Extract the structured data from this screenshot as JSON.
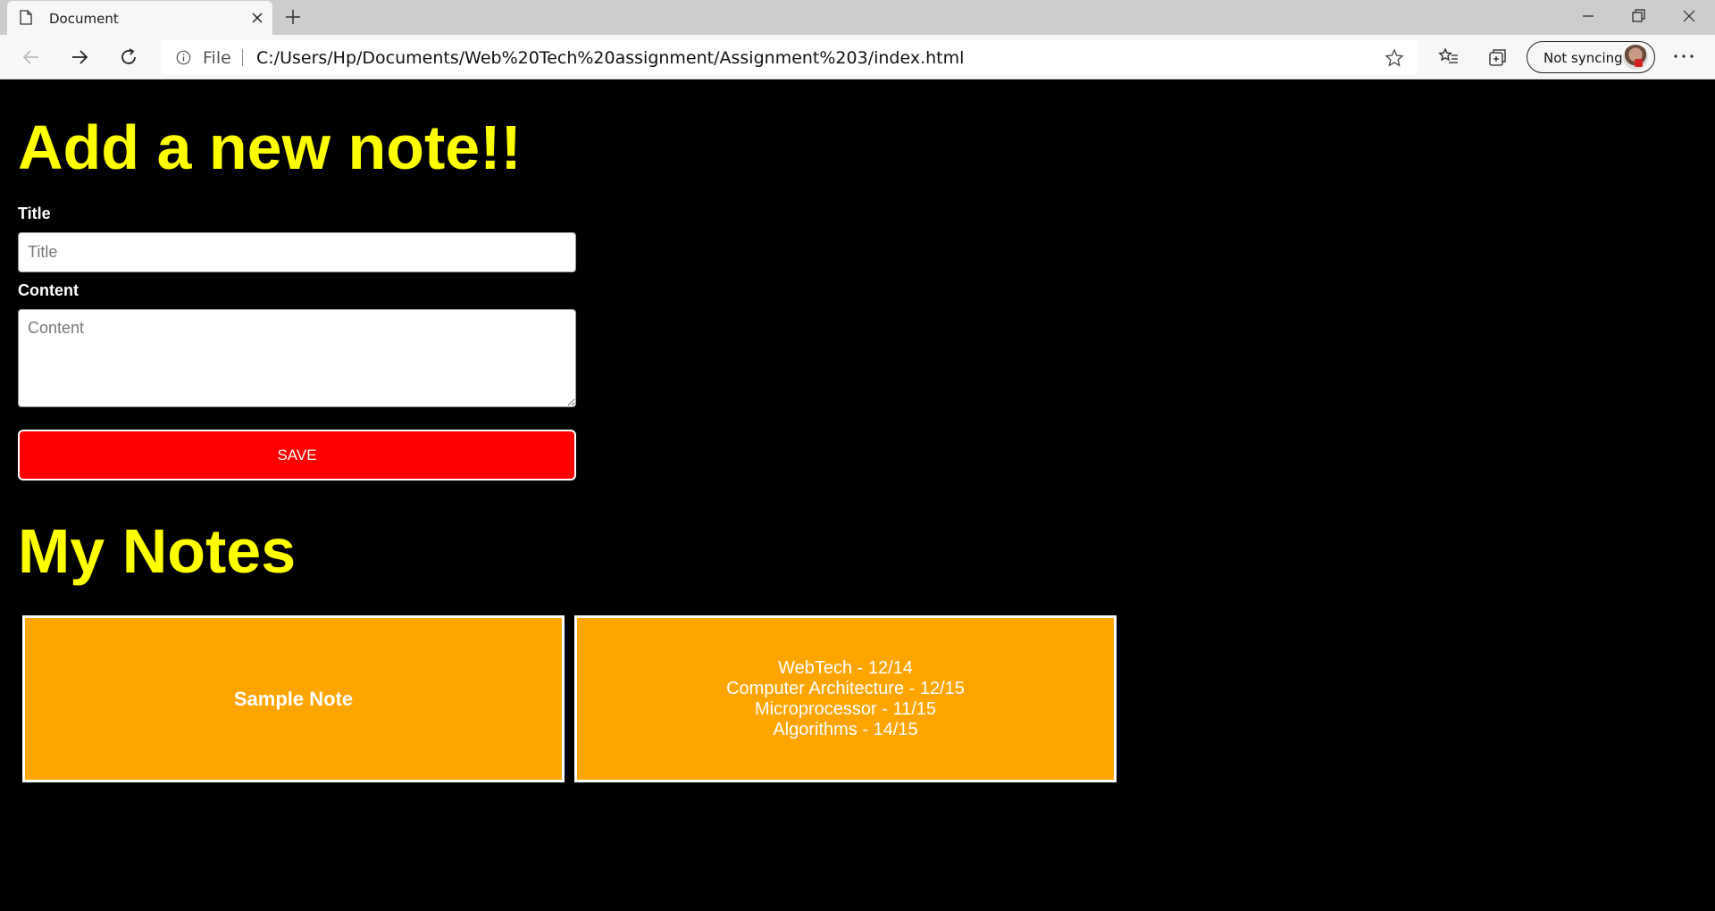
{
  "browser": {
    "tab_title": "Document",
    "address_scheme": "File",
    "url": "C:/Users/Hp/Documents/Web%20Tech%20assignment/Assignment%203/index.html",
    "sync_label": "Not syncing"
  },
  "form": {
    "heading": "Add a new note!!",
    "title_label": "Title",
    "title_placeholder": "Title",
    "content_label": "Content",
    "content_placeholder": "Content",
    "save_label": "SAVE"
  },
  "notes_section": {
    "heading": "My Notes",
    "notes": [
      {
        "title": "Sample Note"
      },
      {
        "lines": [
          "WebTech - 12/14",
          "Computer Architecture - 12/15",
          "Microprocessor - 11/15",
          "Algorithms - 14/15"
        ]
      }
    ]
  },
  "colors": {
    "page_background": "#000000",
    "heading": "#ffff00",
    "save_button": "#ff0000",
    "note_card": "#ffa500"
  }
}
